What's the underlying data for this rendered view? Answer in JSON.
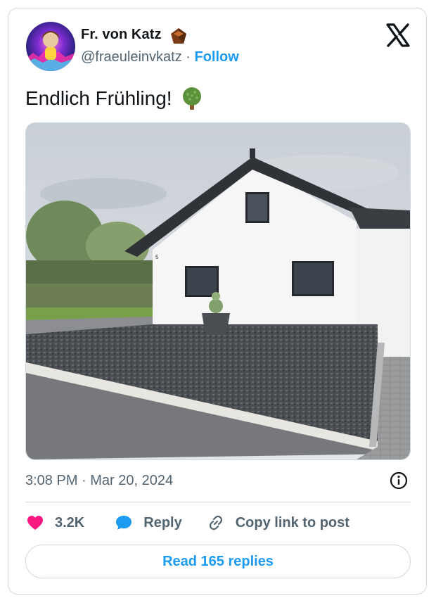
{
  "author": {
    "display_name": "Fr. von Katz",
    "handle": "@fraeuleinvkatz",
    "separator": "·",
    "follow_label": "Follow"
  },
  "tweet": {
    "text": "Endlich Frühling!",
    "emoji_icon": "deciduous-tree-icon",
    "timestamp": "3:08 PM · Mar 20, 2024"
  },
  "actions": {
    "like_count": "3.2K",
    "reply_label": "Reply",
    "copy_link_label": "Copy link to post"
  },
  "read_replies_label": "Read 165 replies",
  "colors": {
    "accent": "#1d9bf0",
    "like": "#f91880",
    "muted_text": "#536471",
    "border": "#cfd9de"
  }
}
